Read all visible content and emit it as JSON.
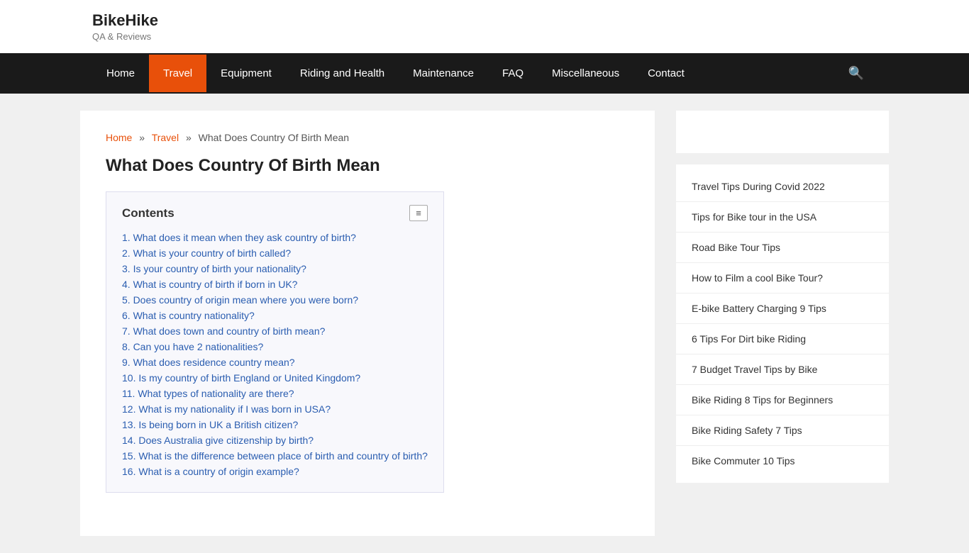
{
  "site": {
    "title": "BikeHike",
    "tagline": "QA & Reviews"
  },
  "nav": {
    "items": [
      {
        "label": "Home",
        "active": false
      },
      {
        "label": "Travel",
        "active": true
      },
      {
        "label": "Equipment",
        "active": false
      },
      {
        "label": "Riding and Health",
        "active": false
      },
      {
        "label": "Maintenance",
        "active": false
      },
      {
        "label": "FAQ",
        "active": false
      },
      {
        "label": "Miscellaneous",
        "active": false
      },
      {
        "label": "Contact",
        "active": false
      }
    ]
  },
  "breadcrumb": {
    "home": "Home",
    "travel": "Travel",
    "current": "What Does Country Of Birth Mean"
  },
  "article": {
    "title": "What Does Country Of Birth Mean"
  },
  "contents": {
    "title": "Contents",
    "toggle_label": "≡",
    "items": [
      {
        "num": "1",
        "text": "What does it mean when they ask country of birth?"
      },
      {
        "num": "2",
        "text": "What is your country of birth called?"
      },
      {
        "num": "3",
        "text": "Is your country of birth your nationality?"
      },
      {
        "num": "4",
        "text": "What is country of birth if born in UK?"
      },
      {
        "num": "5",
        "text": "Does country of origin mean where you were born?"
      },
      {
        "num": "6",
        "text": "What is country nationality?"
      },
      {
        "num": "7",
        "text": "What does town and country of birth mean?"
      },
      {
        "num": "8",
        "text": "Can you have 2 nationalities?"
      },
      {
        "num": "9",
        "text": "What does residence country mean?"
      },
      {
        "num": "10",
        "text": "Is my country of birth England or United Kingdom?"
      },
      {
        "num": "11",
        "text": "What types of nationality are there?"
      },
      {
        "num": "12",
        "text": "What is my nationality if I was born in USA?"
      },
      {
        "num": "13",
        "text": "Is being born in UK a British citizen?"
      },
      {
        "num": "14",
        "text": "Does Australia give citizenship by birth?"
      },
      {
        "num": "15",
        "text": "What is the difference between place of birth and country of birth?"
      },
      {
        "num": "16",
        "text": "What is a country of origin example?"
      }
    ]
  },
  "sidebar": {
    "links": [
      "Travel Tips During Covid 2022",
      "Tips for Bike tour in the USA",
      "Road Bike Tour Tips",
      "How to Film a cool Bike Tour?",
      "E-bike Battery Charging 9 Tips",
      "6 Tips For Dirt bike Riding",
      "7 Budget Travel Tips by Bike",
      "Bike Riding 8 Tips for Beginners",
      "Bike Riding Safety 7 Tips",
      "Bike Commuter 10 Tips"
    ]
  }
}
